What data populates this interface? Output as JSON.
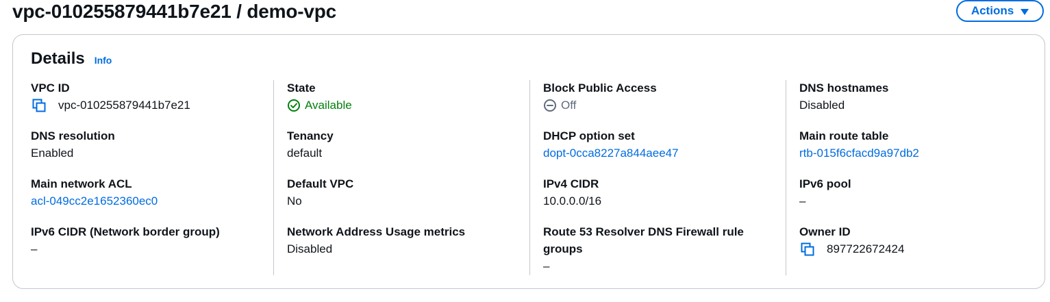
{
  "header": {
    "title": "vpc-010255879441b7e21 / demo-vpc",
    "actions_label": "Actions"
  },
  "details": {
    "title": "Details",
    "info_label": "Info",
    "vpc_id": {
      "label": "VPC ID",
      "value": "vpc-010255879441b7e21"
    },
    "state": {
      "label": "State",
      "value": "Available"
    },
    "block_public_access": {
      "label": "Block Public Access",
      "value": "Off"
    },
    "dns_hostnames": {
      "label": "DNS hostnames",
      "value": "Disabled"
    },
    "dns_resolution": {
      "label": "DNS resolution",
      "value": "Enabled"
    },
    "tenancy": {
      "label": "Tenancy",
      "value": "default"
    },
    "dhcp_option_set": {
      "label": "DHCP option set",
      "value": "dopt-0cca8227a844aee47"
    },
    "main_route_table": {
      "label": "Main route table",
      "value": "rtb-015f6cfacd9a97db2"
    },
    "main_network_acl": {
      "label": "Main network ACL",
      "value": "acl-049cc2e1652360ec0"
    },
    "default_vpc": {
      "label": "Default VPC",
      "value": "No"
    },
    "ipv4_cidr": {
      "label": "IPv4 CIDR",
      "value": "10.0.0.0/16"
    },
    "ipv6_pool": {
      "label": "IPv6 pool",
      "value": "–"
    },
    "ipv6_cidr": {
      "label": "IPv6 CIDR (Network border group)",
      "value": "–"
    },
    "nau_metrics": {
      "label": "Network Address Usage metrics",
      "value": "Disabled"
    },
    "route53_firewall": {
      "label": "Route 53 Resolver DNS Firewall rule groups",
      "value": "–"
    },
    "owner_id": {
      "label": "Owner ID",
      "value": "897722672424"
    }
  },
  "colors": {
    "link": "#006ce0",
    "success": "#037f0c",
    "border": "#c6c6cd",
    "text": "#0f141a"
  },
  "icons": [
    "copy-icon",
    "status-success-icon",
    "status-off-icon",
    "caret-down-icon"
  ]
}
